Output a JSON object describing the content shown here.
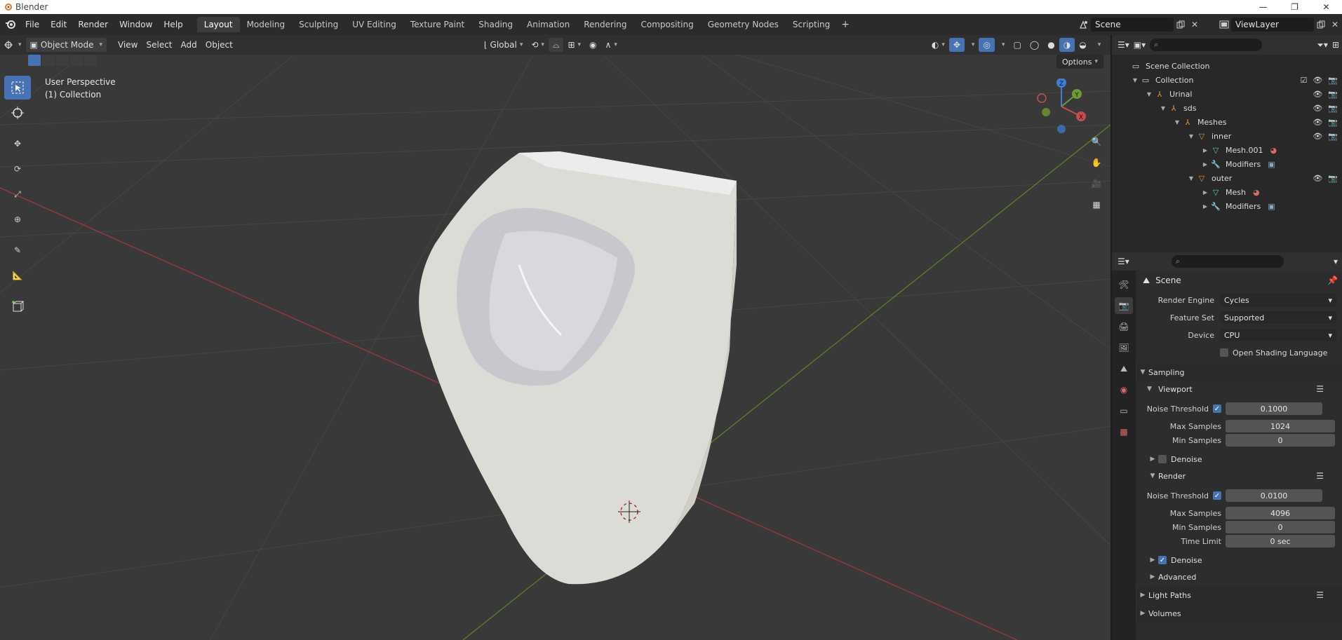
{
  "window": {
    "title": "Blender",
    "controls": [
      "—",
      "❐",
      "✕"
    ]
  },
  "menu": {
    "items": [
      "File",
      "Edit",
      "Render",
      "Window",
      "Help"
    ]
  },
  "workspaces": {
    "tabs": [
      "Layout",
      "Modeling",
      "Sculpting",
      "UV Editing",
      "Texture Paint",
      "Shading",
      "Animation",
      "Rendering",
      "Compositing",
      "Geometry Nodes",
      "Scripting"
    ],
    "active": "Layout",
    "add": "+"
  },
  "scene": {
    "name": "Scene"
  },
  "viewlayer": {
    "name": "ViewLayer"
  },
  "viewport_header": {
    "mode": "Object Mode",
    "menus": [
      "View",
      "Select",
      "Add",
      "Object"
    ],
    "orientation": "Global",
    "options": "Options"
  },
  "viewport": {
    "info_line1": "User Perspective",
    "info_line2": "(1) Collection",
    "gizmo": {
      "x": "X",
      "y": "Y",
      "z": "Z"
    }
  },
  "outliner": {
    "search_placeholder": "",
    "rows": [
      {
        "label": "Scene Collection"
      },
      {
        "label": "Collection"
      },
      {
        "label": "Urinal"
      },
      {
        "label": "sds"
      },
      {
        "label": "Meshes"
      },
      {
        "label": "inner"
      },
      {
        "label": "Mesh.001"
      },
      {
        "label": "Modifiers"
      },
      {
        "label": "outer"
      },
      {
        "label": "Mesh"
      },
      {
        "label": "Modifiers"
      }
    ]
  },
  "properties": {
    "breadcrumb": "Scene",
    "render_engine": {
      "label": "Render Engine",
      "value": "Cycles"
    },
    "feature_set": {
      "label": "Feature Set",
      "value": "Supported"
    },
    "device": {
      "label": "Device",
      "value": "CPU"
    },
    "osl": {
      "label": "Open Shading Language",
      "checked": false
    },
    "sampling": {
      "title": "Sampling",
      "viewport": {
        "title": "Viewport",
        "noise_threshold_label": "Noise Threshold",
        "noise_threshold": "0.1000",
        "max_samples_label": "Max Samples",
        "max_samples": "1024",
        "min_samples_label": "Min Samples",
        "min_samples": "0",
        "denoise_label": "Denoise"
      },
      "render": {
        "title": "Render",
        "noise_threshold_label": "Noise Threshold",
        "noise_threshold": "0.0100",
        "max_samples_label": "Max Samples",
        "max_samples": "4096",
        "min_samples_label": "Min Samples",
        "min_samples": "0",
        "time_limit_label": "Time Limit",
        "time_limit": "0 sec",
        "denoise_label": "Denoise"
      },
      "advanced": "Advanced"
    },
    "light_paths": "Light Paths",
    "volumes": "Volumes"
  },
  "colors": {
    "accent": "#4772b3",
    "x_axis": "#c94c4c",
    "y_axis": "#6d9a31",
    "z_axis": "#3b7fd6"
  }
}
